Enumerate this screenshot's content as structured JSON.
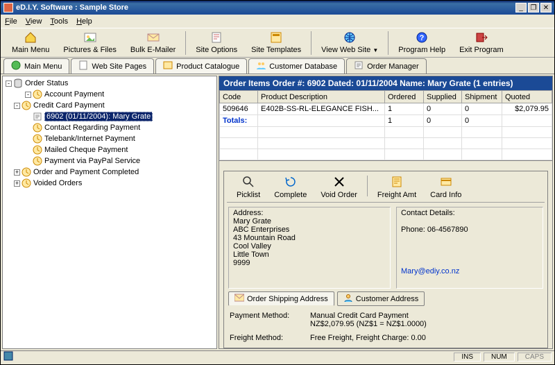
{
  "window": {
    "title": "eD.I.Y. Software :  Sample Store"
  },
  "menubar": [
    {
      "label": "File",
      "u": 0
    },
    {
      "label": "View",
      "u": 0
    },
    {
      "label": "Tools",
      "u": 0
    },
    {
      "label": "Help",
      "u": 0
    }
  ],
  "toolbar": [
    {
      "name": "main-menu-button",
      "label": "Main Menu",
      "icon": "home"
    },
    {
      "name": "pictures-files-button",
      "label": "Pictures & Files",
      "icon": "pictures"
    },
    {
      "name": "bulk-emailer-button",
      "label": "Bulk E-Mailer",
      "icon": "mail"
    },
    {
      "sep": true
    },
    {
      "name": "site-options-button",
      "label": "Site Options",
      "icon": "note"
    },
    {
      "name": "site-templates-button",
      "label": "Site Templates",
      "icon": "template"
    },
    {
      "sep": true
    },
    {
      "name": "view-website-button",
      "label": "View Web Site",
      "icon": "globe",
      "dropdown": true
    },
    {
      "sep": true
    },
    {
      "name": "program-help-button",
      "label": "Program Help",
      "icon": "help"
    },
    {
      "name": "exit-program-button",
      "label": "Exit Program",
      "icon": "exit"
    }
  ],
  "tabs": [
    {
      "name": "tab-main-menu",
      "label": "Main Menu",
      "icon": "green"
    },
    {
      "name": "tab-web-site-pages",
      "label": "Web Site Pages",
      "icon": "page"
    },
    {
      "name": "tab-product-catalogue",
      "label": "Product Catalogue",
      "icon": "catalog"
    },
    {
      "name": "tab-customer-database",
      "label": "Customer Database",
      "icon": "people"
    },
    {
      "name": "tab-order-manager",
      "label": "Order Manager",
      "icon": "order",
      "selected": true
    }
  ],
  "tree": {
    "root_label": "Order Status",
    "items": [
      {
        "indent": 1,
        "pm": "-",
        "icon": "clock",
        "label": "Account Payment",
        "name": "tree-account-payment"
      },
      {
        "indent": 0,
        "pm": "-",
        "icon": "clock",
        "label": "Credit Card Payment",
        "name": "tree-credit-card-payment"
      },
      {
        "indent": 1,
        "pm": "",
        "icon": "order",
        "label": "6902 (01/11/2004): Mary Grate",
        "name": "tree-order-6902",
        "selected": true
      },
      {
        "indent": 1,
        "pm": "",
        "icon": "clock",
        "label": "Contact Regarding Payment",
        "name": "tree-contact-payment"
      },
      {
        "indent": 1,
        "pm": "",
        "icon": "clock",
        "label": "Telebank/Internet Payment",
        "name": "tree-telebank-payment"
      },
      {
        "indent": 1,
        "pm": "",
        "icon": "clock",
        "label": "Mailed Cheque Payment",
        "name": "tree-mailed-cheque"
      },
      {
        "indent": 1,
        "pm": "",
        "icon": "clock",
        "label": "Payment via PayPal Service",
        "name": "tree-paypal"
      },
      {
        "indent": 0,
        "pm": "+",
        "icon": "clock",
        "label": "Order and Payment Completed",
        "name": "tree-completed"
      },
      {
        "indent": 0,
        "pm": "+",
        "icon": "clock",
        "label": "Voided Orders",
        "name": "tree-voided"
      }
    ]
  },
  "order_header": "Order Items     Order #: 6902 Dated: 01/11/2004 Name: Mary Grate (1 entries)",
  "grid": {
    "columns": [
      "Code",
      "Product Description",
      "Ordered",
      "Supplied",
      "Shipment",
      "Quoted"
    ],
    "rows": [
      {
        "code": "509646",
        "desc": "E402B-SS-RL-ELEGANCE FISH...",
        "ordered": "1",
        "supplied": "0",
        "shipment": "0",
        "quoted": "$2,079.95"
      }
    ],
    "totals": {
      "label": "Totals:",
      "ordered": "1",
      "supplied": "0",
      "shipment": "0",
      "quoted": ""
    }
  },
  "actions": [
    {
      "name": "picklist-button",
      "label": "Picklist",
      "icon": "search"
    },
    {
      "name": "complete-button",
      "label": "Complete",
      "icon": "refresh"
    },
    {
      "name": "void-order-button",
      "label": "Void Order",
      "icon": "x"
    },
    {
      "name": "freight-amt-button",
      "label": "Freight Amt",
      "icon": "note2"
    },
    {
      "name": "card-info-button",
      "label": "Card Info",
      "icon": "card"
    }
  ],
  "address": {
    "legend": "Address:",
    "lines": [
      "Mary Grate",
      "ABC Enterprises",
      "43 Mountain Road",
      "Cool Valley",
      "Little Town",
      " 9999"
    ]
  },
  "contact": {
    "legend": "Contact Details:",
    "phone": "Phone: 06-4567890",
    "email": "Mary@ediy.co.nz"
  },
  "addr_tabs": [
    {
      "name": "tab-order-shipping-address",
      "label": "Order Shipping Address",
      "icon": "mail2",
      "selected": true
    },
    {
      "name": "tab-customer-address",
      "label": "Customer Address",
      "icon": "person"
    }
  ],
  "payment": {
    "method_label": "Payment Method:",
    "method_value": "Manual Credit Card Payment",
    "amount": "NZ$2,079.95 (NZ$1 = NZ$1.0000)",
    "freight_label": "Freight Method:",
    "freight_value": "Free Freight, Freight Charge: 0.00"
  },
  "statusbar": {
    "ins": "INS",
    "num": "NUM",
    "caps": "CAPS"
  }
}
